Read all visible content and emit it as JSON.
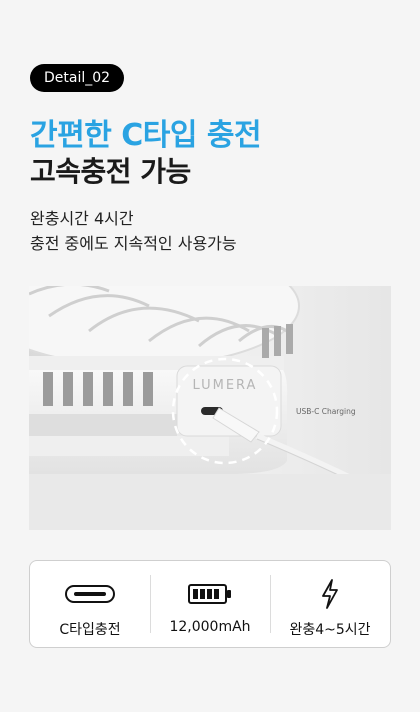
{
  "badge": {
    "label": "Detail_02"
  },
  "headline": {
    "line1": "간편한 C타입 충전",
    "line2": "고속충전 가능"
  },
  "description": {
    "line1": "완충시간 4시간",
    "line2": "충전 중에도 지속적인 사용가능"
  },
  "product_image": {
    "brand": "LUMERA",
    "callout": "USB-C Charging"
  },
  "specs": [
    {
      "icon": "usb-c-port-icon",
      "label": "C타입충전"
    },
    {
      "icon": "battery-full-icon",
      "label": "12,000mAh"
    },
    {
      "icon": "lightning-bolt-icon",
      "label": "완충4~5시간"
    }
  ],
  "colors": {
    "accent": "#2aa3e2",
    "badge_bg": "#000000",
    "background": "#f5f5f5"
  }
}
